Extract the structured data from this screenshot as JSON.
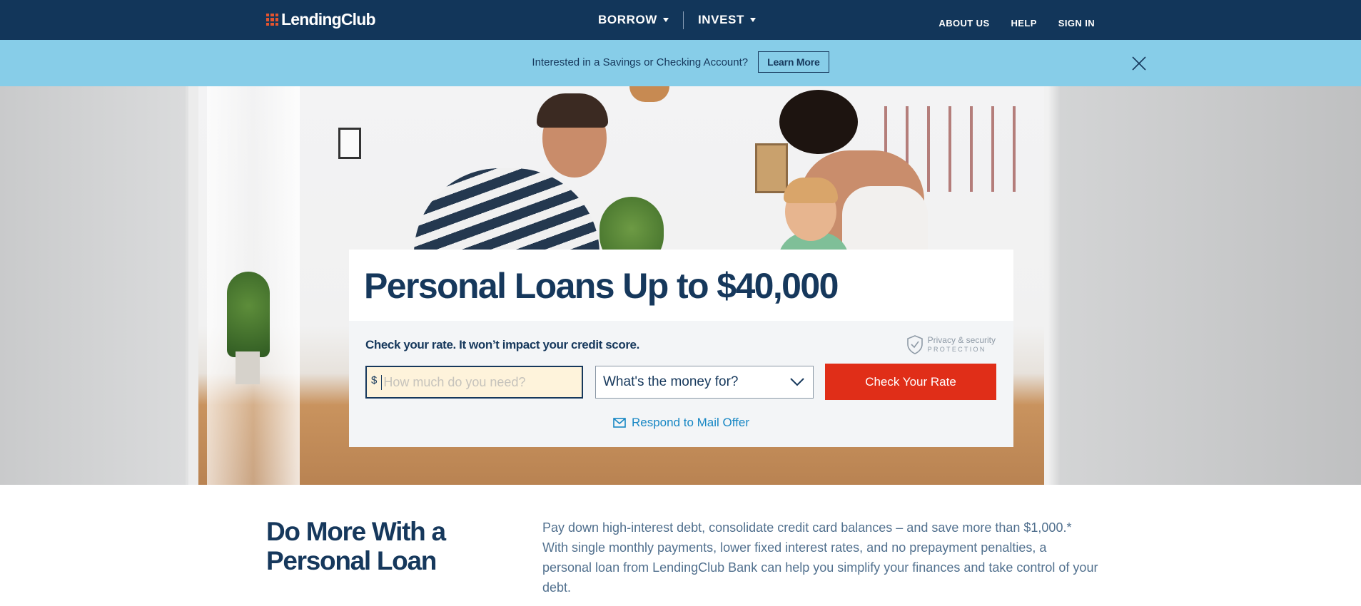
{
  "nav": {
    "logo_text": "LendingClub",
    "borrow": "BORROW",
    "invest": "INVEST",
    "about": "ABOUT US",
    "help": "HELP",
    "signin": "SIGN IN"
  },
  "banner": {
    "text": "Interested in a Savings or Checking Account?",
    "button": "Learn More"
  },
  "hero": {
    "title": "Personal Loans Up to $40,000",
    "check_text": "Check your rate. It won’t impact your credit score.",
    "privacy_line1": "Privacy & security",
    "privacy_line2": "PROTECTION",
    "currency_symbol": "$",
    "amount_placeholder": "How much do you need?",
    "purpose_selected": "What's the money for?",
    "cta": "Check Your Rate",
    "mail_offer": "Respond to Mail Offer"
  },
  "section": {
    "title": "Do More With a Personal Loan",
    "body": "Pay down high-interest debt, consolidate credit card balances – and save more than $1,000.* With single monthly payments, lower fixed interest rates, and no prepayment penalties, a personal loan from LendingClub Bank can help you simplify your finances and take control of your debt."
  },
  "colors": {
    "nav_bg": "#12365a",
    "banner_bg": "#87cde8",
    "cta_bg": "#e02e18",
    "link": "#1787c4",
    "navy_text": "#16385c"
  },
  "icons": [
    "logo-grid-icon",
    "chevron-down-icon",
    "close-icon",
    "shield-check-icon",
    "envelope-icon"
  ]
}
